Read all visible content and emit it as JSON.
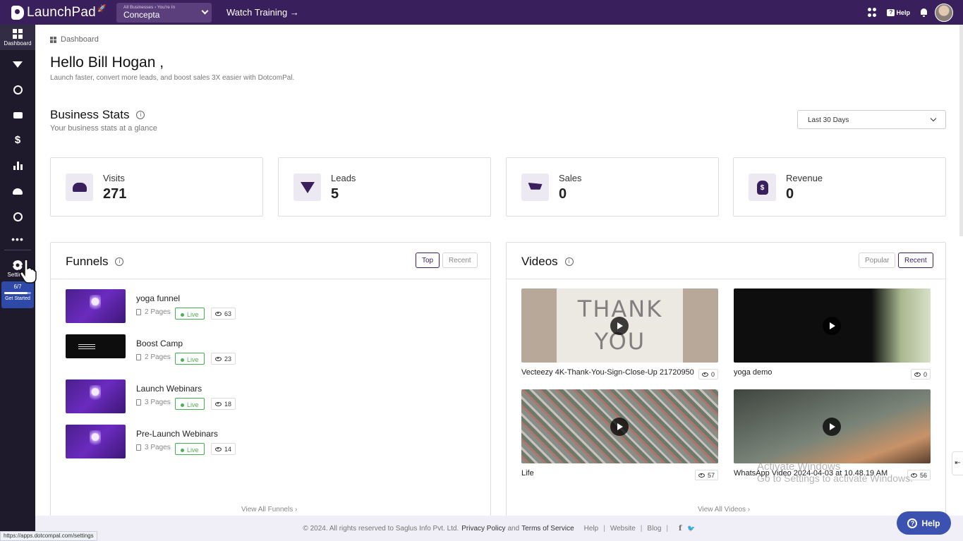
{
  "topbar": {
    "logo_text": "LaunchPad",
    "business_crumb": "All Businesses › You're In",
    "business_name": "Concepta",
    "watch_training": "Watch Training →",
    "help_label": "Help",
    "help_glyph": "?",
    "logo_rocket_glyph": "🚀"
  },
  "sidebar": {
    "items": [
      {
        "icon": "dashboard-icon",
        "label": "Dashboard"
      },
      {
        "icon": "funnel-icon"
      },
      {
        "icon": "globe-icon"
      },
      {
        "icon": "video-icon"
      },
      {
        "icon": "dollar-icon",
        "glyph": "$"
      },
      {
        "icon": "analytics-icon"
      },
      {
        "icon": "users-icon"
      },
      {
        "icon": "gauge-icon"
      },
      {
        "icon": "more-icon",
        "glyph": "•••"
      },
      {
        "icon": "gear-icon",
        "label": "Settings"
      }
    ],
    "progress": {
      "count": "6/7",
      "fraction": 0.857,
      "label": "Get Started"
    }
  },
  "breadcrumb": "Dashboard",
  "greeting": {
    "title": "Hello Bill Hogan ,",
    "subtitle": "Launch faster, convert more leads, and boost sales 3X easier with DotcomPal."
  },
  "business_stats": {
    "title": "Business Stats",
    "info_glyph": "i",
    "subtitle": "Your business stats at a glance",
    "range": "Last 30 Days",
    "cards": [
      {
        "label": "Visits",
        "value": "271",
        "icon": "visits-icon"
      },
      {
        "label": "Leads",
        "value": "5",
        "icon": "leads-funnel-icon"
      },
      {
        "label": "Sales",
        "value": "0",
        "icon": "cart-icon"
      },
      {
        "label": "Revenue",
        "value": "0",
        "icon": "money-bag-icon",
        "glyph": "$"
      }
    ]
  },
  "funnels": {
    "title": "Funnels",
    "tabs": {
      "top": "Top",
      "recent": "Recent"
    },
    "live_label": "Live",
    "items": [
      {
        "name": "yoga funnel",
        "pages": "2 Pages",
        "views": "63"
      },
      {
        "name": "Boost Camp",
        "pages": "2 Pages",
        "views": "23"
      },
      {
        "name": "Launch Webinars",
        "pages": "3 Pages",
        "views": "18"
      },
      {
        "name": "Pre-Launch Webinars",
        "pages": "3 Pages",
        "views": "14"
      }
    ],
    "view_all": "View All Funnels ›"
  },
  "videos": {
    "title": "Videos",
    "tabs": {
      "popular": "Popular",
      "recent": "Recent"
    },
    "items": [
      {
        "title": "Vecteezy 4K-Thank-You-Sign-Close-Up 21720950",
        "views": "0"
      },
      {
        "title": "yoga demo",
        "views": "0"
      },
      {
        "title": "Life",
        "views": "57"
      },
      {
        "title": "WhatsApp Video 2024-04-03 at 10.48.19 AM",
        "views": "56"
      }
    ],
    "view_all": "View All Videos ›"
  },
  "footer": {
    "copyright": "© 2024. All rights reserved to Saglus Info Pvt. Ltd.",
    "privacy": "Privacy Policy",
    "and": "and",
    "terms": "Terms of Service",
    "links": [
      "Help",
      "Website",
      "Blog"
    ],
    "separator": "|",
    "facebook_glyph": "f",
    "twitter_glyph": "🐦"
  },
  "help_fab": {
    "label": "Help",
    "glyph": "?"
  },
  "status_url": "https://apps.dotcompal.com/settings",
  "watermark": {
    "line1": "Activate Windows",
    "line2": "Go to Settings to activate Windows."
  },
  "side_tab_glyph": "⇤",
  "colors": {
    "topbar": "#3a1f5d",
    "sidebar": "#1e1a2b",
    "live": "#4caf50",
    "help_fab": "#3b52b0"
  }
}
